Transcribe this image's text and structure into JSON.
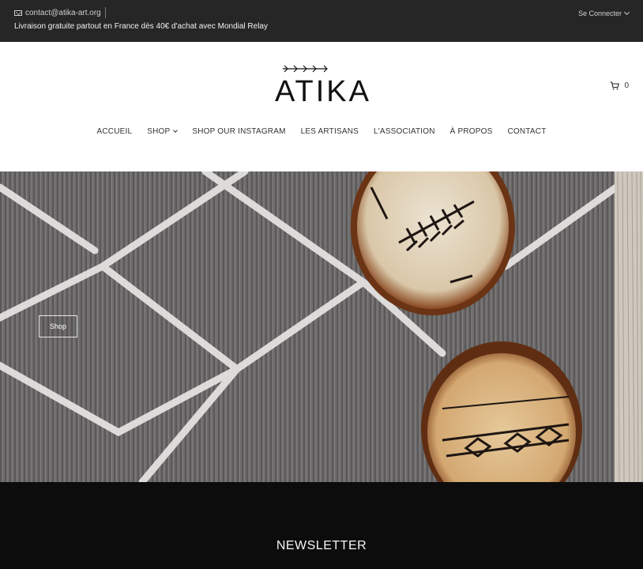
{
  "topbar": {
    "email": "contact@atika-art.org",
    "promo": "Livraison gratuite partout en France dès 40€ d'achat avec Mondial Relay",
    "login": "Se Connecter"
  },
  "header": {
    "logo_text": "ATIKA",
    "cart_count": "0"
  },
  "nav": {
    "items": [
      {
        "label": "ACCUEIL"
      },
      {
        "label": "SHOP"
      },
      {
        "label": "SHOP OUR INSTAGRAM"
      },
      {
        "label": "LES ARTISANS"
      },
      {
        "label": "L'ASSOCIATION"
      },
      {
        "label": "À PROPOS"
      },
      {
        "label": "CONTACT"
      }
    ]
  },
  "hero": {
    "button_label": "Shop"
  },
  "newsletter": {
    "title": "NEWSLETTER"
  },
  "colors": {
    "topbar_bg": "#262626",
    "newsletter_bg": "#0c0c0c"
  }
}
